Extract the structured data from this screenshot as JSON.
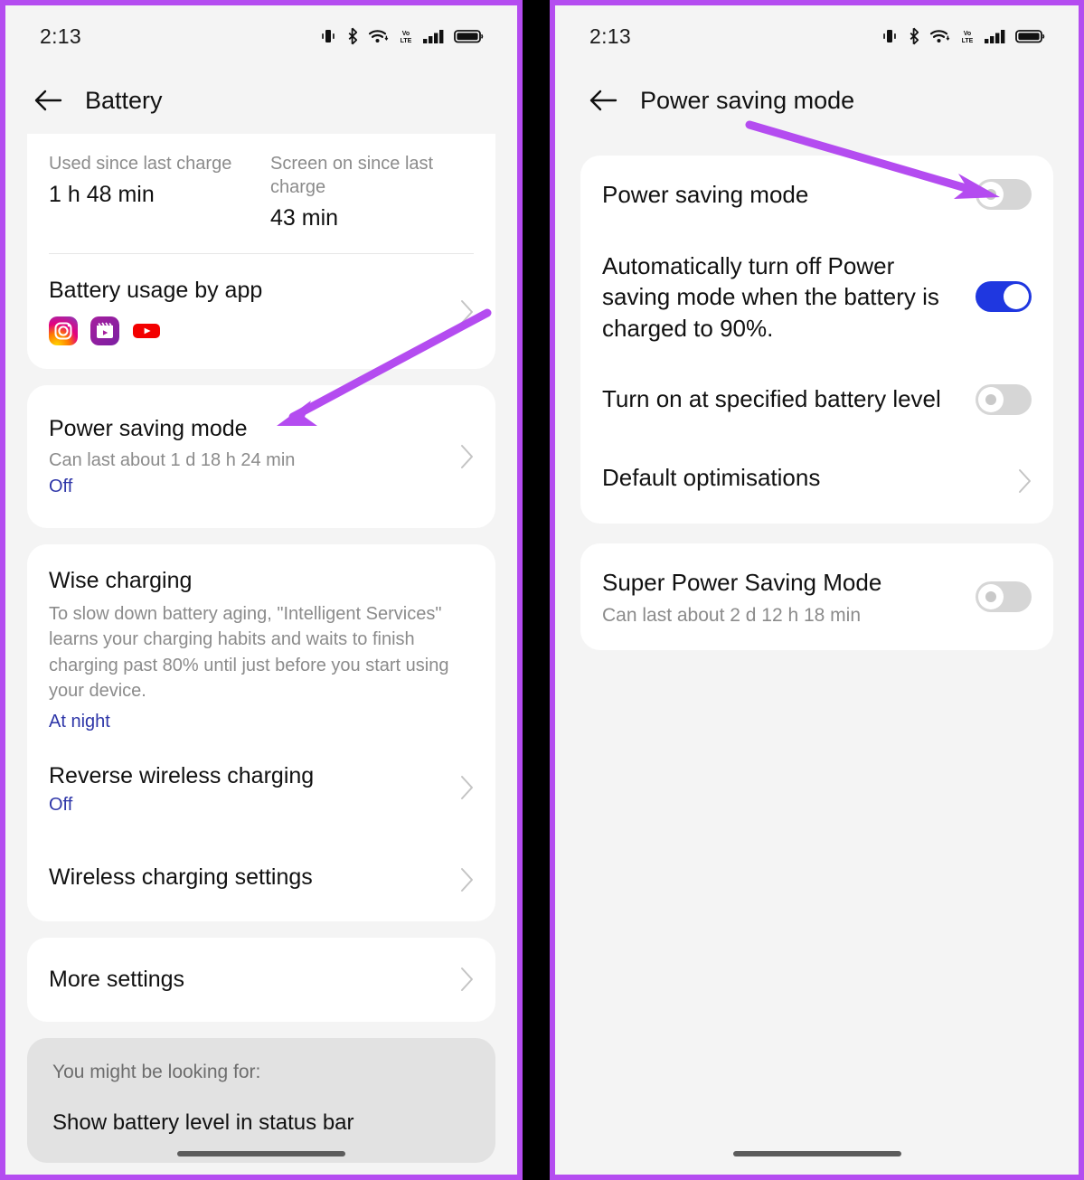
{
  "accent_purple": "#b44cf0",
  "toggle_on_color": "#1f37e0",
  "link_color": "#2e36a8",
  "left": {
    "status": {
      "time": "2:13"
    },
    "appbar": {
      "title": "Battery"
    },
    "stats": {
      "used_label": "Used since last charge",
      "used_value": "1 h 48 min",
      "screen_label": "Screen on since last charge",
      "screen_value": "43 min"
    },
    "usage": {
      "title": "Battery usage by app",
      "apps": [
        "instagram-icon",
        "clips-icon",
        "youtube-icon"
      ]
    },
    "power_saving": {
      "title": "Power saving mode",
      "sub": "Can last about 1 d 18 h 24 min",
      "state": "Off"
    },
    "wise": {
      "title": "Wise charging",
      "desc": "To slow down battery aging, \"Intelligent Services\" learns your charging habits and waits to finish charging past 80% until just before you start using your device.",
      "state": "At night"
    },
    "reverse": {
      "title": "Reverse wireless charging",
      "state": "Off"
    },
    "wireless_settings": {
      "title": "Wireless charging settings"
    },
    "more_settings": {
      "title": "More settings"
    },
    "suggestion": {
      "label": "You might be looking for:",
      "item": "Show battery level in status bar"
    }
  },
  "right": {
    "status": {
      "time": "2:13"
    },
    "appbar": {
      "title": "Power saving mode"
    },
    "rows": [
      {
        "title": "Power saving mode",
        "toggle": "off"
      },
      {
        "title": "Automatically turn off Power saving mode when the battery is charged to 90%.",
        "toggle": "on"
      },
      {
        "title": "Turn on at specified battery level",
        "toggle": "off"
      },
      {
        "title": "Default optimisations",
        "chevron": true
      }
    ],
    "super": {
      "title": "Super Power Saving Mode",
      "sub": "Can last about 2 d 12 h 18 min",
      "toggle": "off"
    }
  }
}
